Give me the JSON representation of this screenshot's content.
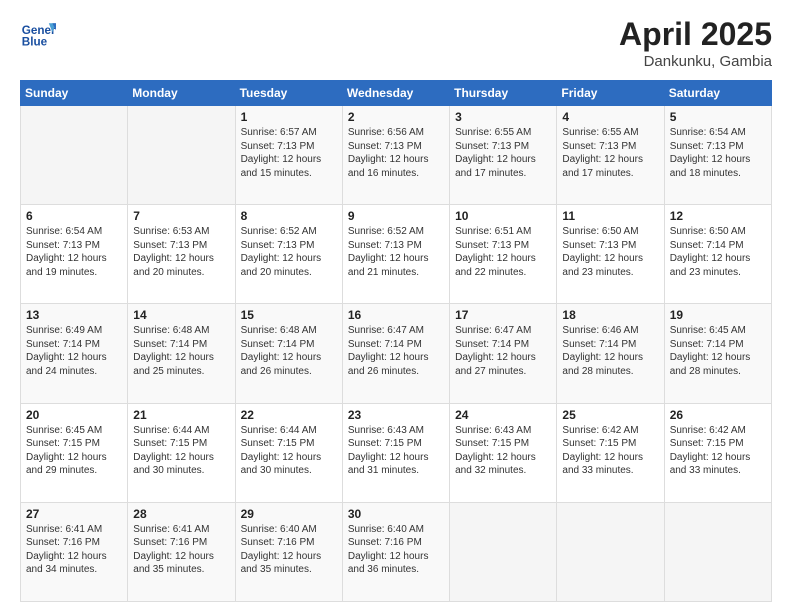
{
  "logo": {
    "line1": "General",
    "line2": "Blue"
  },
  "title": {
    "month": "April 2025",
    "location": "Dankunku, Gambia"
  },
  "days_of_week": [
    "Sunday",
    "Monday",
    "Tuesday",
    "Wednesday",
    "Thursday",
    "Friday",
    "Saturday"
  ],
  "weeks": [
    [
      {
        "day": "",
        "info": ""
      },
      {
        "day": "",
        "info": ""
      },
      {
        "day": "1",
        "sunrise": "6:57 AM",
        "sunset": "7:13 PM",
        "daylight": "12 hours and 15 minutes."
      },
      {
        "day": "2",
        "sunrise": "6:56 AM",
        "sunset": "7:13 PM",
        "daylight": "12 hours and 16 minutes."
      },
      {
        "day": "3",
        "sunrise": "6:55 AM",
        "sunset": "7:13 PM",
        "daylight": "12 hours and 17 minutes."
      },
      {
        "day": "4",
        "sunrise": "6:55 AM",
        "sunset": "7:13 PM",
        "daylight": "12 hours and 17 minutes."
      },
      {
        "day": "5",
        "sunrise": "6:54 AM",
        "sunset": "7:13 PM",
        "daylight": "12 hours and 18 minutes."
      }
    ],
    [
      {
        "day": "6",
        "sunrise": "6:54 AM",
        "sunset": "7:13 PM",
        "daylight": "12 hours and 19 minutes."
      },
      {
        "day": "7",
        "sunrise": "6:53 AM",
        "sunset": "7:13 PM",
        "daylight": "12 hours and 20 minutes."
      },
      {
        "day": "8",
        "sunrise": "6:52 AM",
        "sunset": "7:13 PM",
        "daylight": "12 hours and 20 minutes."
      },
      {
        "day": "9",
        "sunrise": "6:52 AM",
        "sunset": "7:13 PM",
        "daylight": "12 hours and 21 minutes."
      },
      {
        "day": "10",
        "sunrise": "6:51 AM",
        "sunset": "7:13 PM",
        "daylight": "12 hours and 22 minutes."
      },
      {
        "day": "11",
        "sunrise": "6:50 AM",
        "sunset": "7:13 PM",
        "daylight": "12 hours and 23 minutes."
      },
      {
        "day": "12",
        "sunrise": "6:50 AM",
        "sunset": "7:14 PM",
        "daylight": "12 hours and 23 minutes."
      }
    ],
    [
      {
        "day": "13",
        "sunrise": "6:49 AM",
        "sunset": "7:14 PM",
        "daylight": "12 hours and 24 minutes."
      },
      {
        "day": "14",
        "sunrise": "6:48 AM",
        "sunset": "7:14 PM",
        "daylight": "12 hours and 25 minutes."
      },
      {
        "day": "15",
        "sunrise": "6:48 AM",
        "sunset": "7:14 PM",
        "daylight": "12 hours and 26 minutes."
      },
      {
        "day": "16",
        "sunrise": "6:47 AM",
        "sunset": "7:14 PM",
        "daylight": "12 hours and 26 minutes."
      },
      {
        "day": "17",
        "sunrise": "6:47 AM",
        "sunset": "7:14 PM",
        "daylight": "12 hours and 27 minutes."
      },
      {
        "day": "18",
        "sunrise": "6:46 AM",
        "sunset": "7:14 PM",
        "daylight": "12 hours and 28 minutes."
      },
      {
        "day": "19",
        "sunrise": "6:45 AM",
        "sunset": "7:14 PM",
        "daylight": "12 hours and 28 minutes."
      }
    ],
    [
      {
        "day": "20",
        "sunrise": "6:45 AM",
        "sunset": "7:15 PM",
        "daylight": "12 hours and 29 minutes."
      },
      {
        "day": "21",
        "sunrise": "6:44 AM",
        "sunset": "7:15 PM",
        "daylight": "12 hours and 30 minutes."
      },
      {
        "day": "22",
        "sunrise": "6:44 AM",
        "sunset": "7:15 PM",
        "daylight": "12 hours and 30 minutes."
      },
      {
        "day": "23",
        "sunrise": "6:43 AM",
        "sunset": "7:15 PM",
        "daylight": "12 hours and 31 minutes."
      },
      {
        "day": "24",
        "sunrise": "6:43 AM",
        "sunset": "7:15 PM",
        "daylight": "12 hours and 32 minutes."
      },
      {
        "day": "25",
        "sunrise": "6:42 AM",
        "sunset": "7:15 PM",
        "daylight": "12 hours and 33 minutes."
      },
      {
        "day": "26",
        "sunrise": "6:42 AM",
        "sunset": "7:15 PM",
        "daylight": "12 hours and 33 minutes."
      }
    ],
    [
      {
        "day": "27",
        "sunrise": "6:41 AM",
        "sunset": "7:16 PM",
        "daylight": "12 hours and 34 minutes."
      },
      {
        "day": "28",
        "sunrise": "6:41 AM",
        "sunset": "7:16 PM",
        "daylight": "12 hours and 35 minutes."
      },
      {
        "day": "29",
        "sunrise": "6:40 AM",
        "sunset": "7:16 PM",
        "daylight": "12 hours and 35 minutes."
      },
      {
        "day": "30",
        "sunrise": "6:40 AM",
        "sunset": "7:16 PM",
        "daylight": "12 hours and 36 minutes."
      },
      {
        "day": "",
        "info": ""
      },
      {
        "day": "",
        "info": ""
      },
      {
        "day": "",
        "info": ""
      }
    ]
  ],
  "labels": {
    "sunrise": "Sunrise:",
    "sunset": "Sunset:",
    "daylight": "Daylight:"
  }
}
